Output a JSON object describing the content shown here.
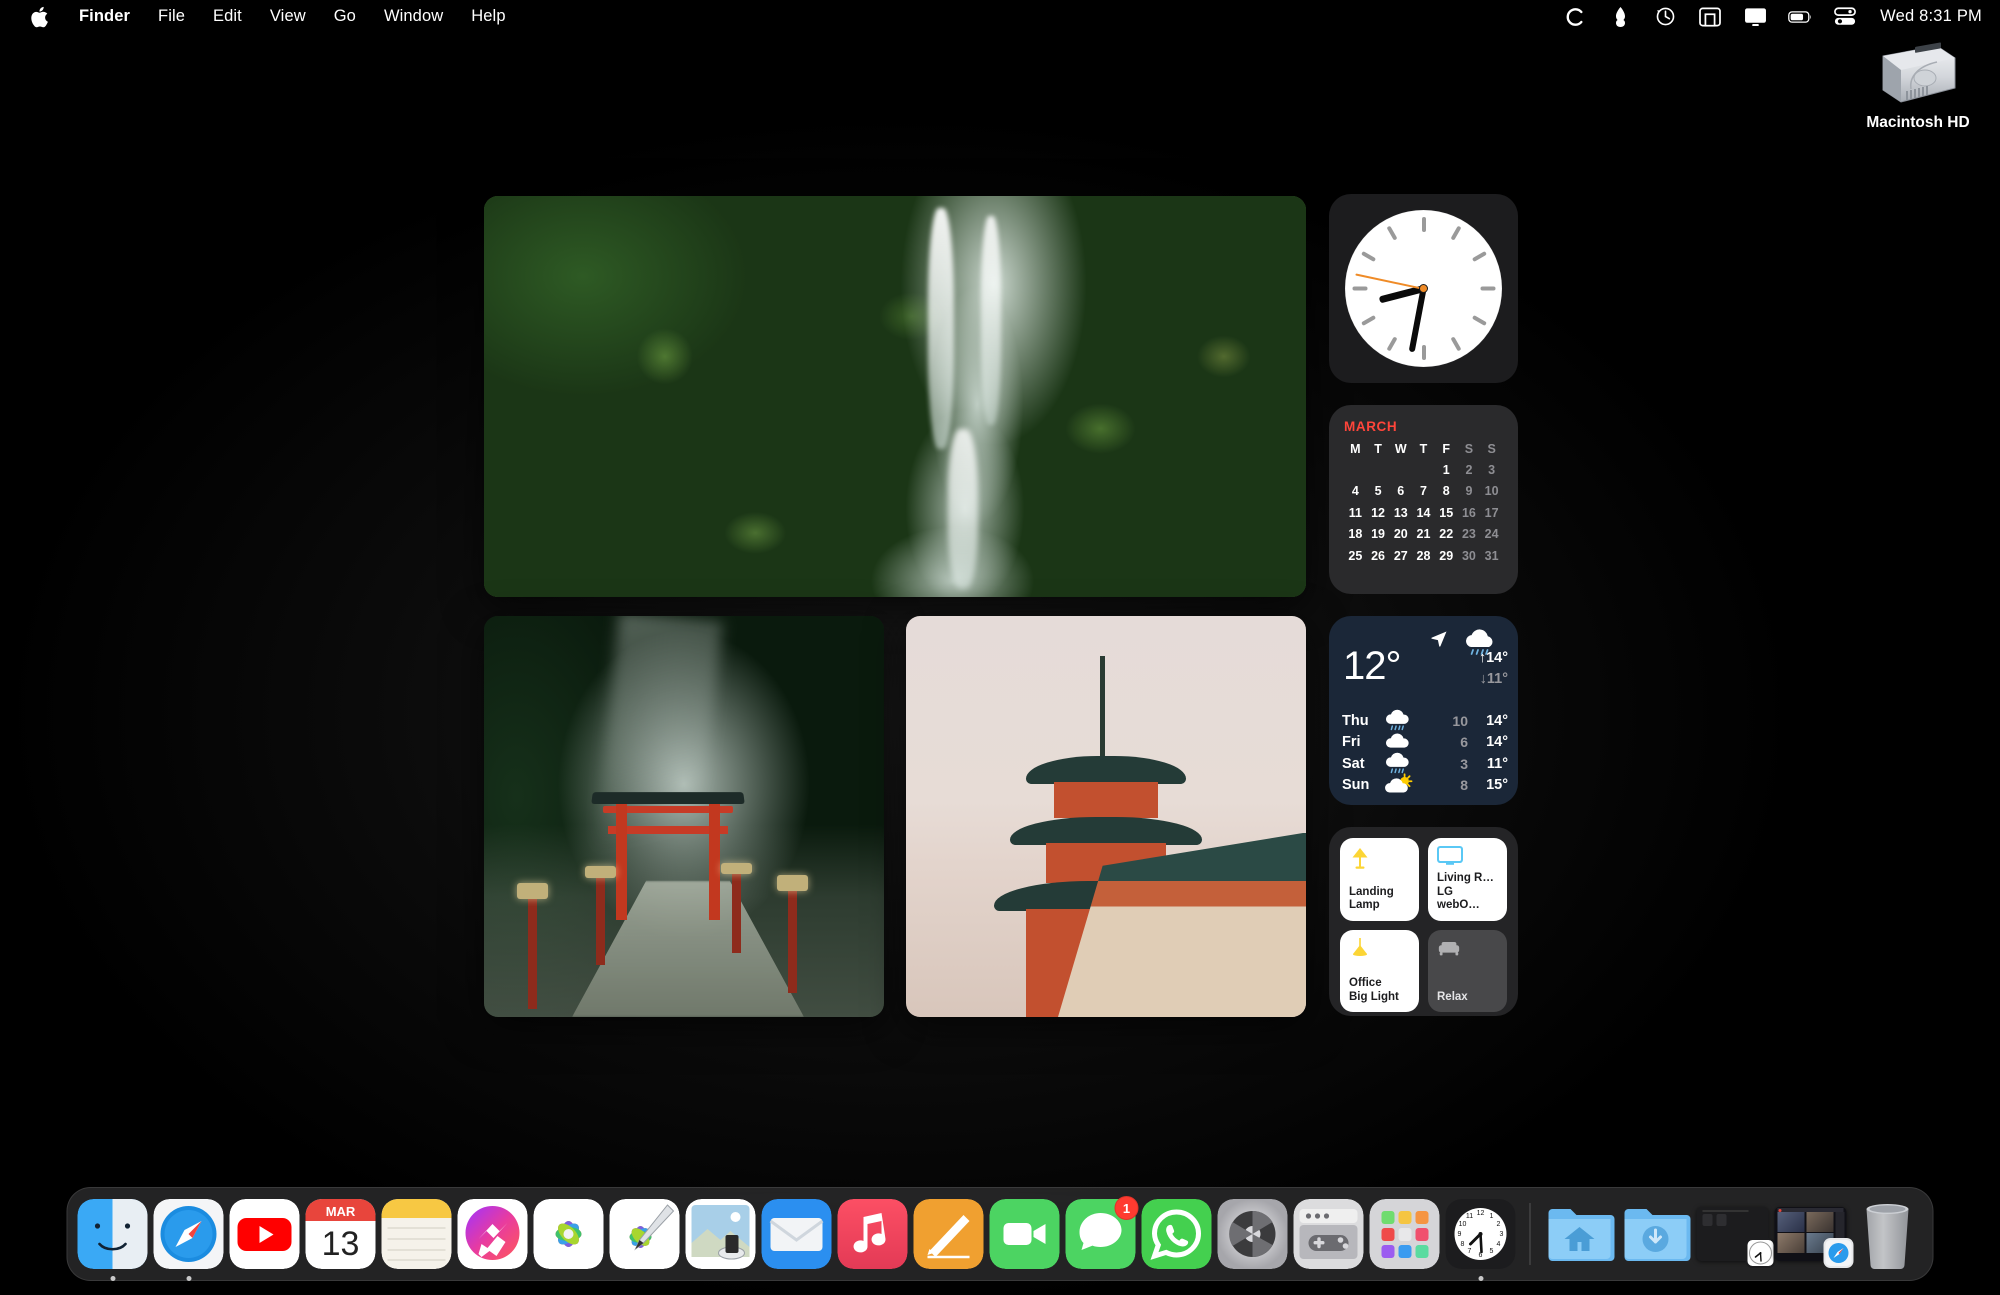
{
  "menubar": {
    "apple_icon": "apple-logo",
    "items": [
      {
        "label": "Finder",
        "bold": true
      },
      {
        "label": "File",
        "bold": false
      },
      {
        "label": "Edit",
        "bold": false
      },
      {
        "label": "View",
        "bold": false
      },
      {
        "label": "Go",
        "bold": false
      },
      {
        "label": "Window",
        "bold": false
      },
      {
        "label": "Help",
        "bold": false
      }
    ],
    "status_icons": [
      {
        "name": "cleanmymac-icon",
        "glyph": "C"
      },
      {
        "name": "flame-icon",
        "glyph": "flame"
      },
      {
        "name": "time-machine-icon",
        "glyph": "clock-arrow"
      },
      {
        "name": "stage-manager-icon",
        "glyph": "stage"
      },
      {
        "name": "display-icon",
        "glyph": "monitor"
      },
      {
        "name": "battery-icon",
        "glyph": "battery"
      },
      {
        "name": "control-center-icon",
        "glyph": "toggles"
      }
    ],
    "clock": "Wed 8:31 PM"
  },
  "desktop": {
    "disk_label": "Macintosh HD"
  },
  "photos": [
    {
      "name": "waterfall-photo",
      "alt": "Mossy green waterfall in a lush forest garden"
    },
    {
      "name": "torii-gate-photo",
      "alt": "Red torii gate on a misty forest path with stone lanterns"
    },
    {
      "name": "pagoda-photo",
      "alt": "Kiyomizu-dera three-storied pagoda at dusk"
    }
  ],
  "widgets": {
    "clock": {
      "title": "Clock",
      "hour": 8,
      "minute": 31,
      "second": 47,
      "hand_color": "#0a0a0a",
      "second_hand_color": "#ef8b27"
    },
    "calendar": {
      "month": "MARCH",
      "accent": "#ff453a",
      "weekdays": [
        "M",
        "T",
        "W",
        "T",
        "F",
        "S",
        "S"
      ],
      "weekend_index": [
        5,
        6
      ],
      "today": 13,
      "leading_blanks": 4,
      "days": [
        1,
        2,
        3,
        4,
        5,
        6,
        7,
        8,
        9,
        10,
        11,
        12,
        13,
        14,
        15,
        16,
        17,
        18,
        19,
        20,
        21,
        22,
        23,
        24,
        25,
        26,
        27,
        28,
        29,
        30,
        31
      ]
    },
    "weather": {
      "current_temp": "12°",
      "high": "↑14°",
      "low": "↓11°",
      "current_icon": "rain-cloud-icon",
      "location_icon": "location-arrow-icon",
      "background": "#1b2738",
      "forecast": [
        {
          "day": "Thu",
          "icon": "rain-cloud-icon",
          "precip": "10",
          "temp": "14°"
        },
        {
          "day": "Fri",
          "icon": "cloud-icon",
          "precip": "6",
          "temp": "14°"
        },
        {
          "day": "Sat",
          "icon": "rain-cloud-icon",
          "precip": "3",
          "temp": "11°"
        },
        {
          "day": "Sun",
          "icon": "sun-cloud-icon",
          "precip": "8",
          "temp": "15°"
        }
      ]
    },
    "home": {
      "tiles": [
        {
          "name": "landing-lamp",
          "icon": "lamp-icon",
          "line1": "Landing",
          "line2": "Lamp",
          "state": "on"
        },
        {
          "name": "living-room-tv",
          "icon": "tv-icon",
          "line1": "Living R…",
          "line2": "LG webO…",
          "state": "on"
        },
        {
          "name": "office-big-light",
          "icon": "pendant-light-icon",
          "line1": "Office",
          "line2": "Big Light",
          "state": "on"
        },
        {
          "name": "relax-scene",
          "icon": "sofa-icon",
          "line1": "Relax",
          "line2": "",
          "state": "off"
        }
      ]
    }
  },
  "dock": {
    "apps": [
      {
        "name": "finder",
        "label": "Finder",
        "running": true
      },
      {
        "name": "safari",
        "label": "Safari",
        "running": true
      },
      {
        "name": "youtube",
        "label": "YouTube",
        "running": false
      },
      {
        "name": "calendar",
        "label": "Calendar",
        "month": "MAR",
        "day": "13",
        "running": false
      },
      {
        "name": "notes",
        "label": "Notes",
        "running": false
      },
      {
        "name": "messenger",
        "label": "Messenger",
        "running": false
      },
      {
        "name": "photos",
        "label": "Photos",
        "running": false
      },
      {
        "name": "image-playground",
        "label": "Image Playground",
        "running": false
      },
      {
        "name": "preview",
        "label": "Preview",
        "running": false
      },
      {
        "name": "mail",
        "label": "Mail",
        "running": false
      },
      {
        "name": "music",
        "label": "Music",
        "running": false
      },
      {
        "name": "freeform",
        "label": "Freeform",
        "running": false
      },
      {
        "name": "facetime",
        "label": "FaceTime",
        "running": false
      },
      {
        "name": "messages",
        "label": "Messages",
        "badge": "1",
        "running": false
      },
      {
        "name": "whatsapp",
        "label": "WhatsApp",
        "running": false
      },
      {
        "name": "system-settings",
        "label": "System Settings",
        "running": false
      },
      {
        "name": "game-center",
        "label": "Game Center",
        "running": false
      },
      {
        "name": "launchpad",
        "label": "Launchpad",
        "running": false
      },
      {
        "name": "clock",
        "label": "Clock",
        "running": true
      }
    ],
    "others": [
      {
        "name": "home-folder",
        "label": "Home"
      },
      {
        "name": "downloads-folder",
        "label": "Downloads"
      },
      {
        "name": "minimized-clock-window",
        "label": "Clock window"
      },
      {
        "name": "minimized-safari-window",
        "label": "Safari video call window"
      },
      {
        "name": "trash",
        "label": "Trash"
      }
    ]
  }
}
